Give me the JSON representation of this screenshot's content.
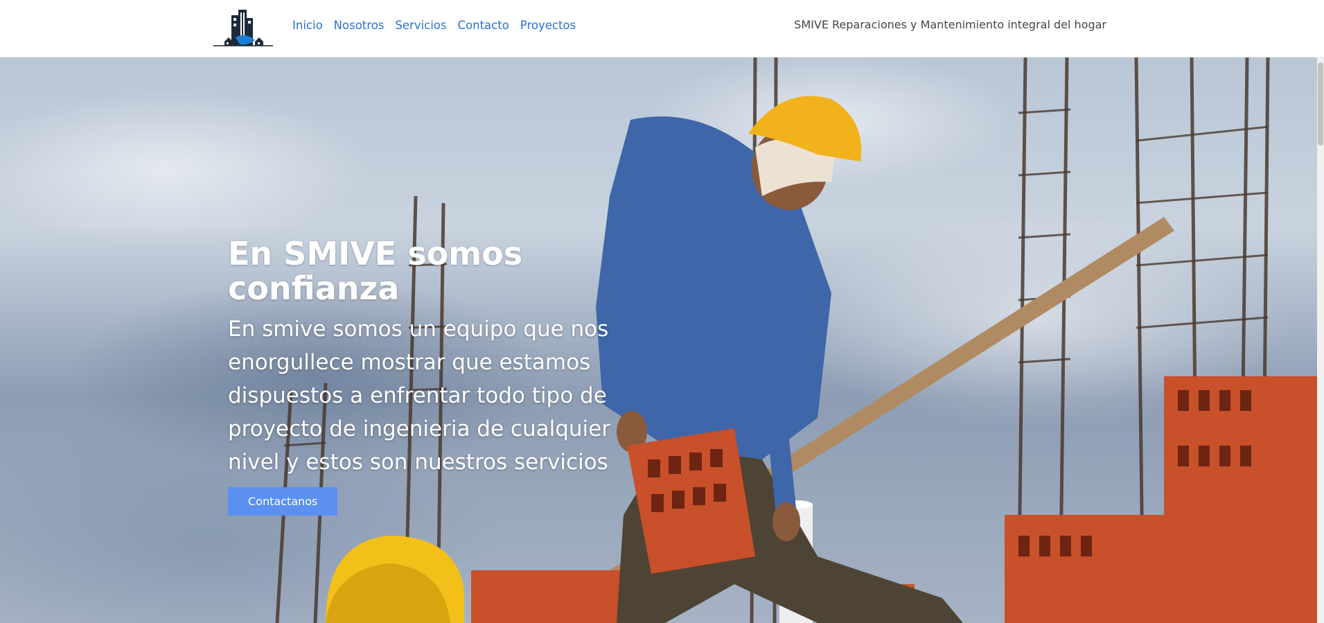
{
  "header": {
    "nav": [
      {
        "label": "Inicio"
      },
      {
        "label": "Nosotros"
      },
      {
        "label": "Servicios"
      },
      {
        "label": "Contacto"
      },
      {
        "label": "Proyectos"
      }
    ],
    "tagline": "SMIVE Reparaciones y Mantenimiento integral del hogar"
  },
  "hero": {
    "title": "En SMIVE somos confianza",
    "text": "En smive somos un equipo que nos enorgullece mostrar que estamos dispuestos a enfrentar todo tipo de proyecto de ingenieria de cualquier nivel y estos son nuestros servicios",
    "cta_label": "Contactanos"
  },
  "colors": {
    "nav_link": "#2a6fd6",
    "cta": "#5b8ff0",
    "logo_blue": "#1a7fd6"
  }
}
